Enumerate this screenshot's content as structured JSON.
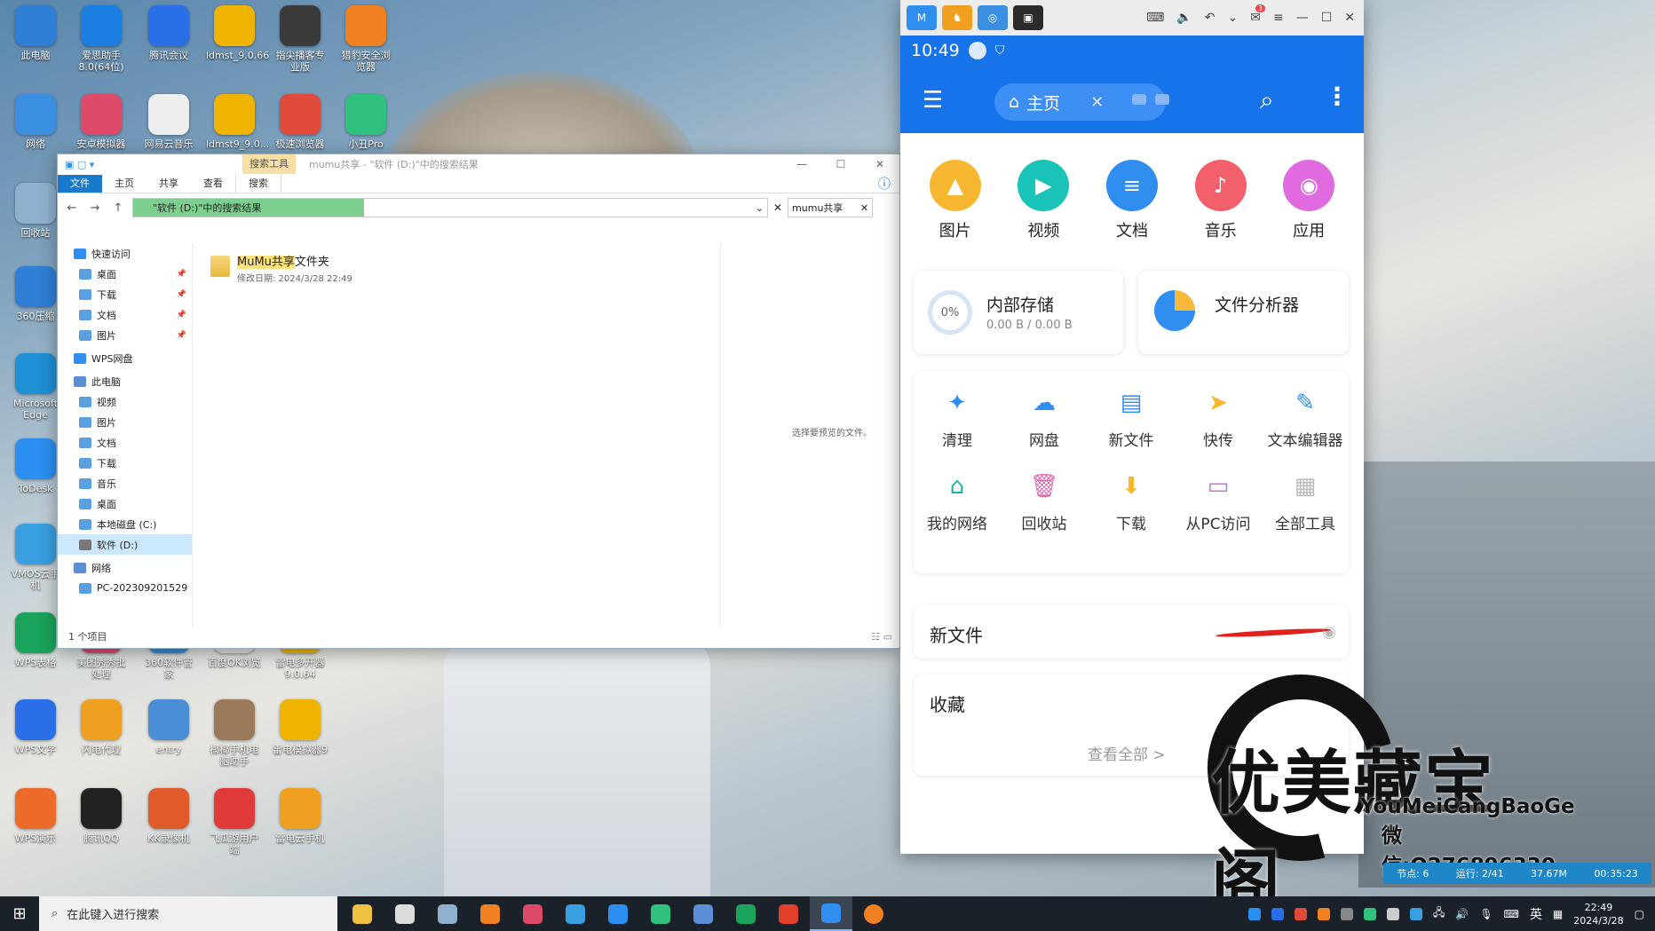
{
  "desktop": {
    "icons": [
      {
        "label": "此电脑",
        "color": "#2f7fd6"
      },
      {
        "label": "爱思助手 8.0(64位)",
        "color": "#1a7fe0"
      },
      {
        "label": "腾讯会议",
        "color": "#2a6fe8"
      },
      {
        "label": "ldmst_9.0.66",
        "color": "#f0b400"
      },
      {
        "label": "指尖播客专业版",
        "color": "#3a3a3a"
      },
      {
        "label": "猎豹安全浏览器",
        "color": "#f08020"
      },
      {
        "label": "网络",
        "color": "#3a8fe0"
      },
      {
        "label": "安卓模拟器",
        "color": "#e04a6a"
      },
      {
        "label": "网易云音乐",
        "color": "#eeeeee"
      },
      {
        "label": "ldmst9_9.0...",
        "color": "#f0b400"
      },
      {
        "label": "极速浏览器",
        "color": "#e04a3a"
      },
      {
        "label": "小丑Pro",
        "color": "#2ec27e"
      },
      {
        "label": "回收站",
        "color": "#8fb0cf"
      },
      {
        "label": "360压缩",
        "color": "#2f7fd6"
      },
      {
        "label": "Microsoft Edge",
        "color": "#1f8fd6"
      },
      {
        "label": "ToDesk",
        "color": "#2a8ff0"
      },
      {
        "label": "VMOS云手机",
        "color": "#3a9fe0"
      },
      {
        "label": "WPS表格",
        "color": "#1aa35a"
      },
      {
        "label": "WPS文字",
        "color": "#2a6fe8"
      },
      {
        "label": "WPS演示",
        "color": "#ee6a2a"
      },
      {
        "label": "美图秀秀批处理",
        "color": "#e04a6a"
      },
      {
        "label": "360软件管家",
        "color": "#2f8ee0"
      },
      {
        "label": "百度OK浏览",
        "color": "#e0e0e0"
      },
      {
        "label": "雷电多开器 9.0.64",
        "color": "#f0b400"
      },
      {
        "label": "闪电代理",
        "color": "#f0a020"
      },
      {
        "label": "entry",
        "color": "#4a8fd6"
      },
      {
        "label": "椰椰手机电脑助手",
        "color": "#9a7a5a"
      },
      {
        "label": "雷电模拟器9",
        "color": "#f0b400"
      },
      {
        "label": "腾讯QQ",
        "color": "#222222"
      },
      {
        "label": "KK录像机",
        "color": "#e05a2a"
      },
      {
        "label": "飞瓜游用户端",
        "color": "#e03a3a"
      },
      {
        "label": "雷电云手机",
        "color": "#f0a020"
      }
    ]
  },
  "explorer": {
    "context_tab": "搜索工具",
    "title": "mumu共享 - \"软件 (D:)\"中的搜索结果",
    "ribbon": [
      "文件",
      "主页",
      "共享",
      "查看",
      "搜索"
    ],
    "address": "\"软件 (D:)\"中的搜索结果",
    "search_value": "mumu共享",
    "sidebar": [
      {
        "label": "快速访问",
        "type": "star"
      },
      {
        "label": "桌面",
        "type": "pin"
      },
      {
        "label": "下载",
        "type": "pin"
      },
      {
        "label": "文档",
        "type": "pin"
      },
      {
        "label": "图片",
        "type": "pin"
      },
      {
        "label": "WPS网盘",
        "type": "cloud"
      },
      {
        "label": "此电脑",
        "type": "pc"
      },
      {
        "label": "视频",
        "type": ""
      },
      {
        "label": "图片",
        "type": ""
      },
      {
        "label": "文档",
        "type": ""
      },
      {
        "label": "下载",
        "type": ""
      },
      {
        "label": "音乐",
        "type": ""
      },
      {
        "label": "桌面",
        "type": ""
      },
      {
        "label": "本地磁盘 (C:)",
        "type": ""
      },
      {
        "label": "软件 (D:)",
        "type": "selected"
      },
      {
        "label": "网络",
        "type": "net"
      },
      {
        "label": "PC-202309201529",
        "type": ""
      }
    ],
    "file_name_highlight": "MuMu共享",
    "file_name_rest": "文件夹",
    "file_date": "修改日期: 2024/3/28 22:49",
    "preview_text": "选择要预览的文件。",
    "status": "1 个项目"
  },
  "emulator": {
    "status_time": "10:49",
    "home_tab": "主页",
    "categories": [
      {
        "label": "图片",
        "color": "#f7b731",
        "icon": "▲"
      },
      {
        "label": "视频",
        "color": "#19c3b8",
        "icon": "▶"
      },
      {
        "label": "文档",
        "color": "#2f8ef0",
        "icon": "≡"
      },
      {
        "label": "音乐",
        "color": "#f2616b",
        "icon": "♪"
      },
      {
        "label": "应用",
        "color": "#e06ae0",
        "icon": "◉"
      }
    ],
    "storage": {
      "title": "内部存储",
      "percent": "0%",
      "detail": "0.00 B / 0.00 B"
    },
    "analyzer": "文件分析器",
    "tools": [
      {
        "label": "清理",
        "icon": "✦",
        "color": "#2f8ef0"
      },
      {
        "label": "网盘",
        "icon": "☁",
        "color": "#2f8ef0"
      },
      {
        "label": "新文件",
        "icon": "▤",
        "color": "#2f8ef0"
      },
      {
        "label": "快传",
        "icon": "➤",
        "color": "#f7b731"
      },
      {
        "label": "文本编辑器",
        "icon": "✎",
        "color": "#2f8ef0"
      },
      {
        "label": "我的网络",
        "icon": "⌂",
        "color": "#19b3a8"
      },
      {
        "label": "回收站",
        "icon": "🗑",
        "color": "#e06ab0"
      },
      {
        "label": "下载",
        "icon": "⬇",
        "color": "#f7b731"
      },
      {
        "label": "从PC访问",
        "icon": "▭",
        "color": "#c86ae0"
      },
      {
        "label": "全部工具",
        "icon": "▦",
        "color": "#bbbbbb"
      }
    ],
    "new_files": "新文件",
    "favorites": "收藏",
    "view_all": "查看全部 >"
  },
  "watermark": {
    "cn": "优美藏宝阁",
    "en": "YouMeiCangBaoGe",
    "wx": "微信:Q276896330"
  },
  "stats": [
    "节点: 6",
    "运行: 2/41",
    "37.67M",
    "00:35:23"
  ],
  "taskbar": {
    "search_placeholder": "在此键入进行搜索",
    "lang": "英",
    "time": "22:49",
    "date": "2024/3/28"
  }
}
